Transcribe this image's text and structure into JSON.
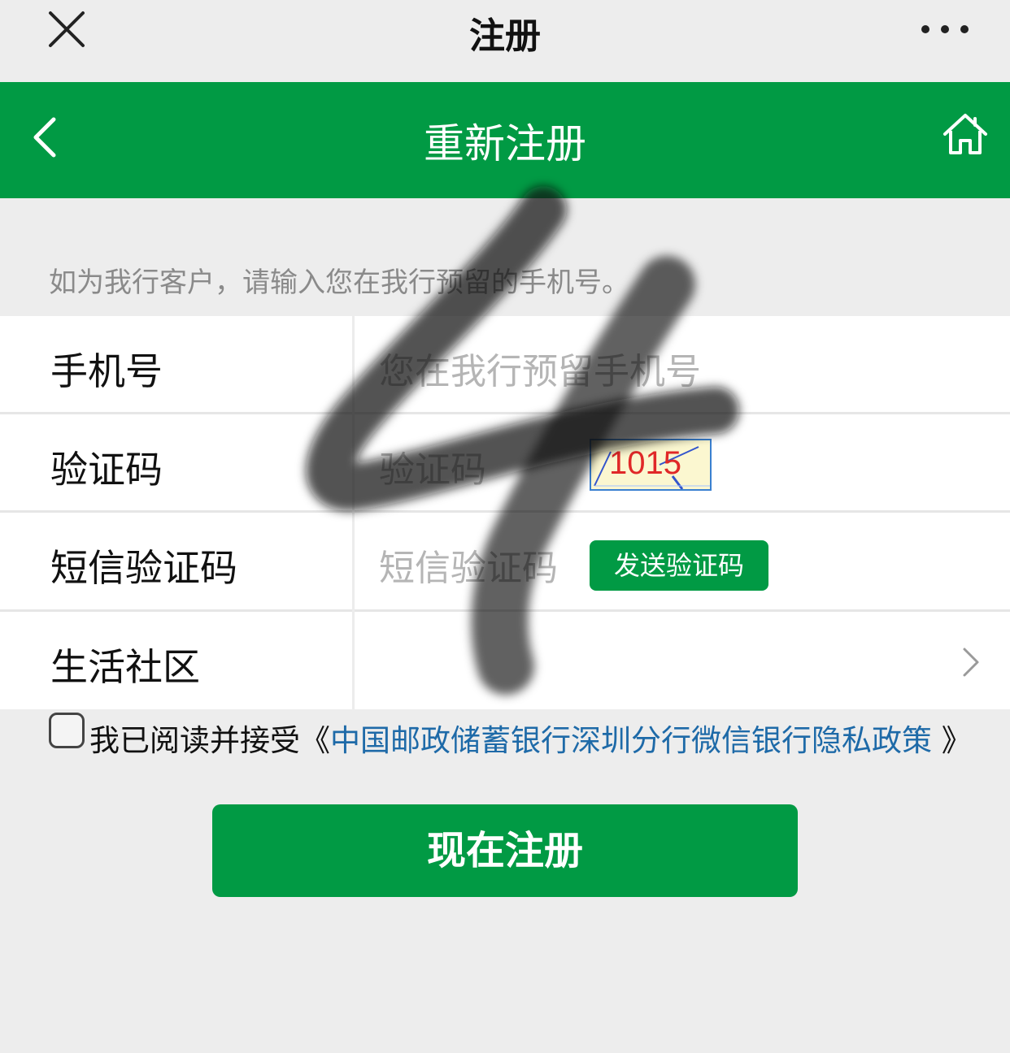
{
  "topbar": {
    "title": "注册",
    "close_icon": "close-icon",
    "more_icon": "more-icon"
  },
  "header": {
    "title": "重新注册",
    "back_icon": "chevron-left-icon",
    "home_icon": "home-icon",
    "color": "#019a44"
  },
  "hint": "如为我行客户，请输入您在我行预留的手机号。",
  "form": {
    "phone": {
      "label": "手机号",
      "placeholder": "您在我行预留手机号"
    },
    "captcha": {
      "label": "验证码",
      "placeholder": "验证码",
      "image_text": "1015"
    },
    "sms": {
      "label": "短信验证码",
      "placeholder": "短信验证码",
      "button": "发送验证码"
    },
    "community": {
      "label": "生活社区",
      "icon": "chevron-right-icon"
    }
  },
  "agreement": {
    "prefix": "我已阅读并接受《",
    "link": "中国邮政储蓄银行深圳分行微信银行隐私政策",
    "suffix": " 》",
    "checked": false
  },
  "submit": "现在注册"
}
